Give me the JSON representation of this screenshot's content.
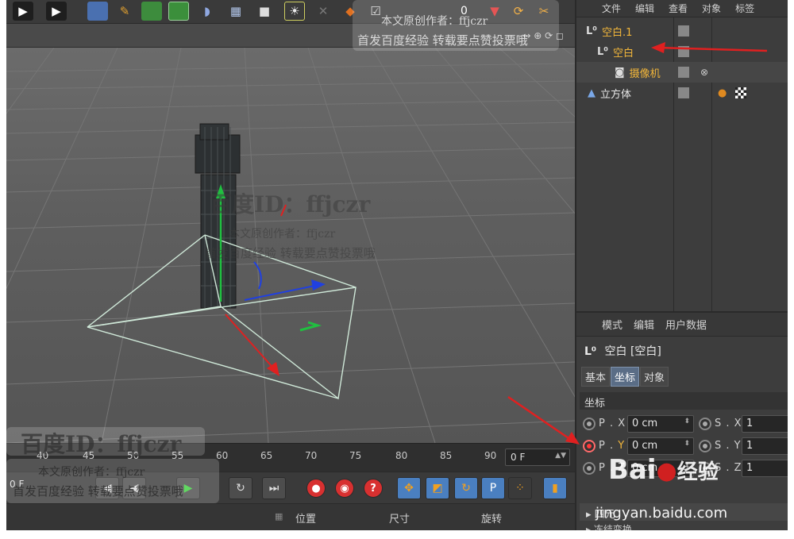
{
  "object_manager": {
    "menu": [
      "文件",
      "编辑",
      "查看",
      "对象",
      "标签"
    ],
    "objects": [
      {
        "name": "空白.1",
        "indent": 0
      },
      {
        "name": "空白",
        "indent": 1
      },
      {
        "name": "摄像机",
        "indent": 2
      },
      {
        "name": "立方体",
        "indent": 0
      }
    ]
  },
  "attributes": {
    "menu": [
      "模式",
      "编辑",
      "用户数据"
    ],
    "object_title": "空白 [空白]",
    "tabs": [
      "基本",
      "坐标",
      "对象"
    ],
    "active_tab": "坐标",
    "section": "坐标",
    "position": [
      {
        "label": "P . X",
        "axis": "X",
        "value": "0 cm"
      },
      {
        "label": "P . Y",
        "axis": "Y",
        "value": "0 cm"
      },
      {
        "label": "P . Z",
        "axis": "Z",
        "value": "0 cm"
      }
    ],
    "scale": [
      {
        "label": "S . X",
        "value": "1"
      },
      {
        "label": "S . Y",
        "value": "1"
      },
      {
        "label": "S . Z",
        "value": "1"
      }
    ],
    "quaternion_label": "四元",
    "freeze_label": "冻结变换"
  },
  "toolbar": {
    "counter": "0"
  },
  "timeline": {
    "ticks": [
      "40",
      "45",
      "50",
      "55",
      "60",
      "65",
      "70",
      "75",
      "80",
      "85",
      "90"
    ],
    "current_frame": "0 F",
    "left_value": "0 F"
  },
  "coord_manager": {
    "headers": [
      "位置",
      "尺寸",
      "旋转"
    ]
  },
  "watermarks": {
    "baidu_id": "百度ID：ffjczr",
    "author": "本文原创作者：ffjczr",
    "notice": "首发百度经验 转载要点赞投票哦",
    "site": "jingyan.baidu.com",
    "logo_text": "Bai",
    "logo_cn": "经验"
  },
  "colors": {
    "selected_object": "#f2b63a",
    "annotation_arrow": "#e02020",
    "active_tab": "#5a6d86"
  }
}
